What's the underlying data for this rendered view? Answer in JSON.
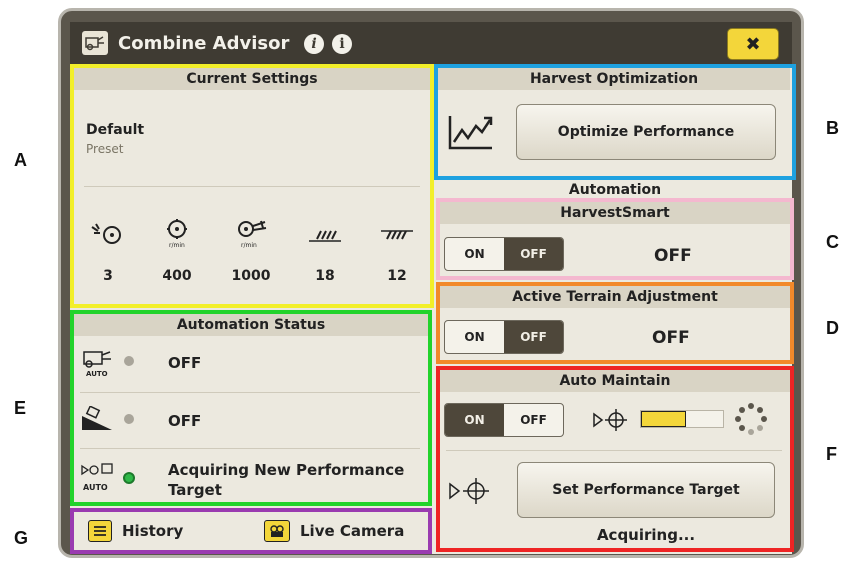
{
  "window": {
    "title": "Combine Advisor",
    "close_label": "✖"
  },
  "current_settings": {
    "header": "Current Settings",
    "preset_name": "Default",
    "preset_caption": "Preset",
    "values": [
      {
        "icon": "fan-icon",
        "value": "3"
      },
      {
        "icon": "rotor-speed-icon",
        "value": "400",
        "unit": "r/min"
      },
      {
        "icon": "fan-speed-icon",
        "value": "1000",
        "unit": "r/min"
      },
      {
        "icon": "concave-icon",
        "value": "18"
      },
      {
        "icon": "sieve-icon",
        "value": "12"
      }
    ]
  },
  "harvest_optimization": {
    "header": "Harvest Optimization",
    "button_label": "Optimize Performance"
  },
  "automation": {
    "header": "Automation",
    "harvestsmart": {
      "header": "HarvestSmart",
      "on_label": "ON",
      "off_label": "OFF",
      "state": "OFF"
    },
    "terrain": {
      "header": "Active Terrain Adjustment",
      "on_label": "ON",
      "off_label": "OFF",
      "state": "OFF"
    },
    "auto_maintain": {
      "header": "Auto Maintain",
      "on_label": "ON",
      "off_label": "OFF",
      "progress_fraction": 0.55,
      "button_label": "Set Performance Target",
      "status": "Acquiring..."
    }
  },
  "automation_status": {
    "header": "Automation Status",
    "rows": [
      {
        "icon": "harvestsmart-auto-icon",
        "text": "OFF",
        "led": "#a9a59a"
      },
      {
        "icon": "terrain-adjustment-icon",
        "text": "OFF",
        "led": "#a9a59a"
      },
      {
        "icon": "auto-maintain-icon",
        "text": "Acquiring New Performance Target",
        "led": "#2fb847"
      }
    ]
  },
  "footer": {
    "history_label": "History",
    "camera_label": "Live Camera"
  },
  "callouts": [
    "A",
    "B",
    "C",
    "D",
    "E",
    "F",
    "G"
  ],
  "colors": {
    "A": "#f2ef2a",
    "B": "#1ea1e0",
    "C": "#f4b8cf",
    "D": "#f2892a",
    "E": "#22d32b",
    "F": "#ee2424",
    "G": "#9a3bb0",
    "accent": "#f3d63a"
  }
}
